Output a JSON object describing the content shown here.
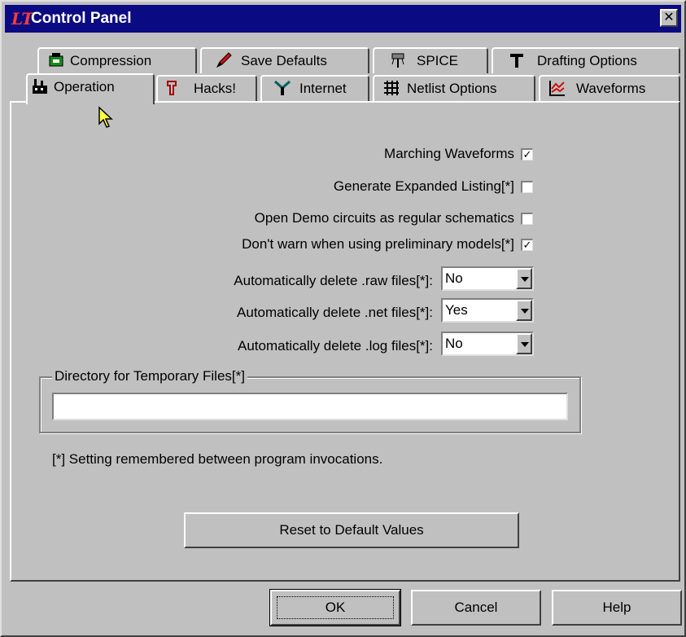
{
  "window": {
    "title": "Control Panel",
    "close_glyph": "✕"
  },
  "tabs": {
    "back_row": [
      {
        "label": "Compression",
        "icon": "compression-icon"
      },
      {
        "label": "Save Defaults",
        "icon": "pencil-icon"
      },
      {
        "label": "SPICE",
        "icon": "probe-icon"
      },
      {
        "label": "Drafting Options",
        "icon": "hammer-icon"
      }
    ],
    "front_row": [
      {
        "label": "Operation",
        "icon": "factory-icon",
        "active": true
      },
      {
        "label": "Hacks!",
        "icon": "wrench-icon"
      },
      {
        "label": "Internet",
        "icon": "antenna-icon"
      },
      {
        "label": "Netlist Options",
        "icon": "grid-icon"
      },
      {
        "label": "Waveforms",
        "icon": "waveform-icon"
      }
    ]
  },
  "options": {
    "checkboxes": [
      {
        "label": "Marching Waveforms",
        "checked": true
      },
      {
        "label": "Generate Expanded Listing[*]",
        "checked": false
      },
      {
        "label": "Open Demo circuits as regular schematics",
        "checked": false
      },
      {
        "label": "Don't warn when using preliminary models[*]",
        "checked": true
      }
    ],
    "selects": [
      {
        "label": "Automatically delete .raw files[*]:",
        "value": "No"
      },
      {
        "label": "Automatically delete .net files[*]:",
        "value": "Yes"
      },
      {
        "label": "Automatically delete .log files[*]:",
        "value": "No"
      }
    ],
    "check_mark": "✓"
  },
  "temp_dir": {
    "legend": "Directory for Temporary Files[*]",
    "value": ""
  },
  "note": "[*] Setting remembered between program invocations.",
  "buttons": {
    "reset": "Reset to Default Values",
    "ok": "OK",
    "cancel": "Cancel",
    "help": "Help"
  },
  "colors": {
    "title_bar": "#0a0a82",
    "face": "#c0c0c0"
  }
}
